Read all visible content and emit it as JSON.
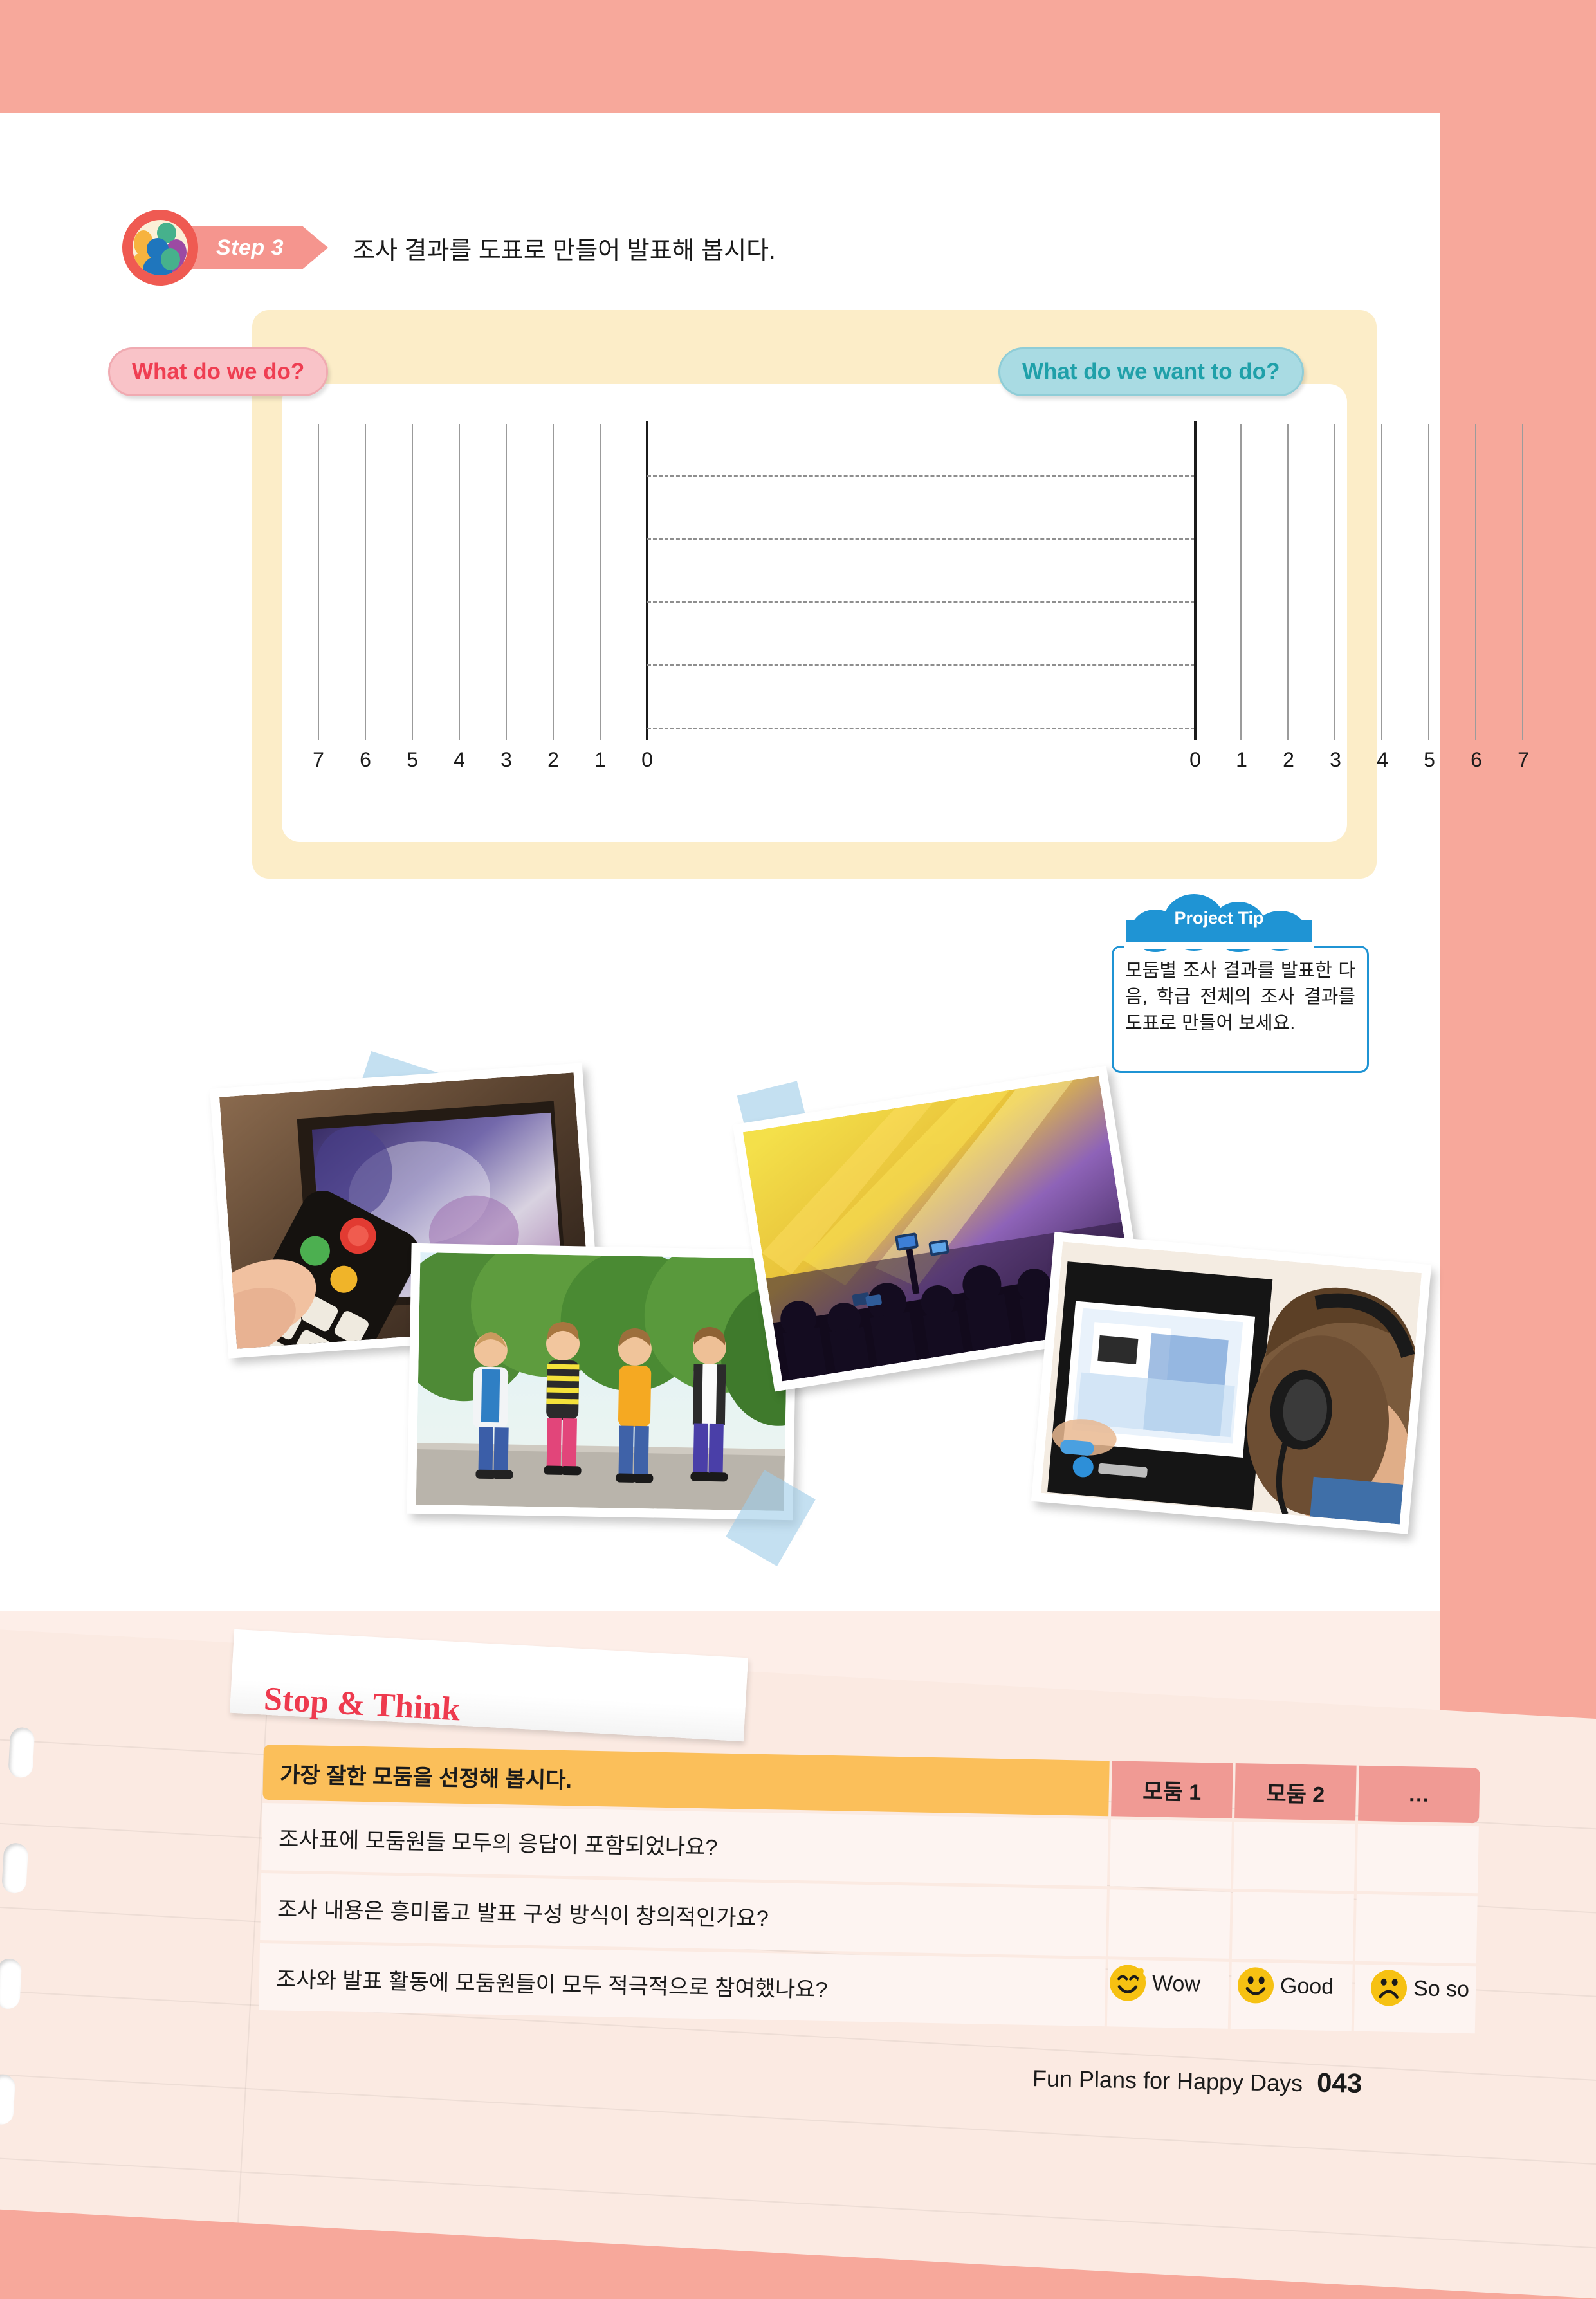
{
  "page": {
    "background_color": "#f7a89b",
    "sheet_color": "#ffffff",
    "page_number": "043",
    "footer_title": "Fun Plans for Happy Days"
  },
  "step": {
    "badge_label": "Step 3",
    "instruction": "조사 결과를 도표로 만들어 발표해 봅시다.",
    "icon": "group-people-icon",
    "badge_color": "#f5958e",
    "ring_color": "#ef5a52"
  },
  "chart_card": {
    "card_color": "#fcedc8",
    "panel_color": "#ffffff",
    "left_badge": {
      "label": "What do we do?",
      "bg": "#f9c3c8",
      "text_color": "#ef3e52",
      "border": "#f0aab1"
    },
    "right_badge": {
      "label": "What do we want to do?",
      "bg": "#a9dbe3",
      "text_color": "#1fa0a9",
      "border": "#8fcdd7"
    }
  },
  "chart_data": {
    "type": "bar",
    "title": "What do we do? / What do we want to do?",
    "orientation": "horizontal-diverging-blank",
    "left_axis_label": "What do we do?",
    "right_axis_label": "What do we want to do?",
    "left_ticks": [
      "7",
      "6",
      "5",
      "4",
      "3",
      "2",
      "1",
      "0"
    ],
    "right_ticks": [
      "0",
      "1",
      "2",
      "3",
      "4",
      "5",
      "6",
      "7"
    ],
    "xlim_left": [
      7,
      0
    ],
    "xlim_right": [
      0,
      7
    ],
    "categories": [
      "",
      "",
      "",
      "",
      "",
      ""
    ],
    "series": [
      {
        "name": "What do we do?",
        "values": [
          0,
          0,
          0,
          0,
          0,
          0
        ]
      },
      {
        "name": "What do we want to do?",
        "values": [
          0,
          0,
          0,
          0,
          0,
          0
        ]
      }
    ],
    "row_count": 6,
    "dashed_row_lines": 5,
    "grid": true,
    "grid_style": "vertical solid gridlines on value ticks; horizontal dashed row separators between the two zero axes",
    "legend": "none",
    "note": "Blank worksheet template — no bars are drawn; students fill it in."
  },
  "project_tip": {
    "label": "Project Tip",
    "text": "모둠별 조사 결과를 발표한 다음, 학급 전체의 조사 결과를 도표로 만들어 보세요.",
    "accent_color": "#1f94d4"
  },
  "photos": [
    {
      "name": "tv-remote-photo",
      "alt": "hand holding TV remote in front of television"
    },
    {
      "name": "rollerblading-kids-photo",
      "alt": "four children rollerblading outdoors"
    },
    {
      "name": "concert-photo",
      "alt": "concert crowd with yellow and purple stage lights"
    },
    {
      "name": "headphones-computer-photo",
      "alt": "boy with headphones at a computer monitor"
    }
  ],
  "stop_and_think": {
    "title": "Stop & Think",
    "header_question": "가장 잘한 모둠을 선정해 봅시다.",
    "group_columns": [
      "모둠 1",
      "모둠 2",
      "…"
    ],
    "header_bg": "#fbbf5a",
    "group_bg": "#f09a94",
    "rows": [
      "조사표에 모둠원들 모두의 응답이 포함되었나요?",
      "조사 내용은 흥미롭고 발표 구성 방식이 창의적인가요?",
      "조사와 발표 활동에 모둠원들이 모두 적극적으로 참여했나요?"
    ]
  },
  "legend": [
    {
      "label": "Wow",
      "icon": "smiley-happy-icon"
    },
    {
      "label": "Good",
      "icon": "smiley-good-icon"
    },
    {
      "label": "So so",
      "icon": "smiley-sad-icon"
    }
  ]
}
